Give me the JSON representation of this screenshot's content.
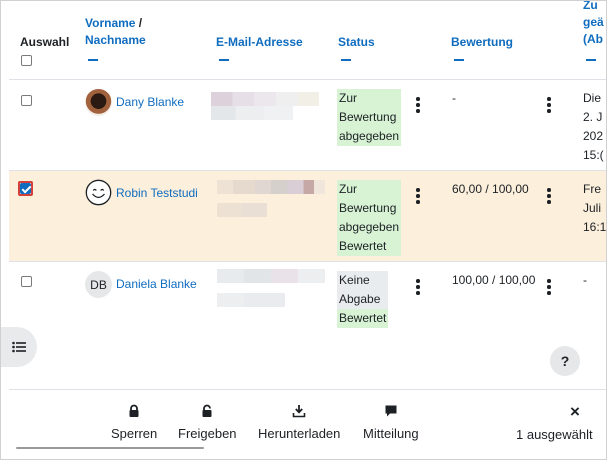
{
  "headers": {
    "auswahl": "Auswahl",
    "vorname": "Vorname",
    "slash": " /",
    "nachname": "Nachname",
    "email": "E-Mail-Adresse",
    "status": "Status",
    "bewertung": "Bewertung",
    "zuletzt_1": "Zu",
    "zuletzt_2": "geä",
    "zuletzt_3": "(Ab"
  },
  "rows": [
    {
      "name": "Dany Blanke",
      "selected": false,
      "avatar": "photo-avatar",
      "status": [
        "Zur",
        "Bewertung",
        "abgegeben"
      ],
      "grade": "-",
      "modified": [
        "Die",
        "2. J",
        "202",
        "15:("
      ]
    },
    {
      "name": "Robin Teststudi",
      "selected": true,
      "avatar": "smiley-avatar",
      "status": [
        "Zur",
        "Bewertung",
        "abgegeben",
        "Bewertet"
      ],
      "grade": "60,00 / 100,00",
      "modified": [
        "Fre",
        "Juli",
        "16:1"
      ]
    },
    {
      "name": "Daniela Blanke",
      "selected": false,
      "avatar": "initials-avatar",
      "initials": "DB",
      "status": [
        "Keine",
        "Abgabe",
        "Bewertet"
      ],
      "grade": "100,00 / 100,00",
      "modified": [
        "-"
      ]
    }
  ],
  "help_label": "?",
  "footer": {
    "sperren": "Sperren",
    "freigeben": "Freigeben",
    "herunterladen": "Herunterladen",
    "mitteilung": "Mitteilung",
    "close": "×",
    "selected_count": "1 ausgewählt"
  },
  "colors": {
    "link": "#0f6cbf",
    "selected_row": "#fcefdc",
    "status_green": "#d7f3d4",
    "status_gray": "#e9ecef"
  }
}
